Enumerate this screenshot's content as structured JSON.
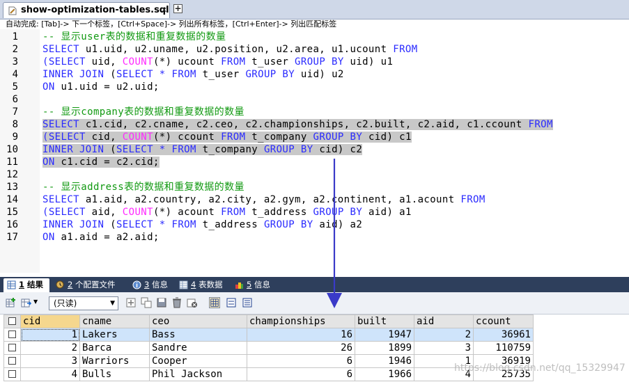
{
  "file_tab": {
    "title": "show-optimization-tables.sql",
    "close": "✕",
    "new_tab": "+"
  },
  "hint": "自动完成:  [Tab]-> 下一个标签，[Ctrl+Space]-> 列出所有标签，[Ctrl+Enter]-> 列出匹配标签",
  "editor": {
    "line_numbers": [
      "1",
      "2",
      "3",
      "4",
      "5",
      "6",
      "7",
      "8",
      "9",
      "10",
      "11",
      "12",
      "13",
      "14",
      "15",
      "16",
      "17"
    ],
    "lines": [
      [
        {
          "c": "cm",
          "t": "-- 显示user表的数据和重复数据的数量"
        }
      ],
      [
        {
          "c": "kw",
          "t": "SELECT"
        },
        {
          "t": " u1.uid, u2.uname, u2.position, u2.area, u1.ucount "
        },
        {
          "c": "kw",
          "t": "FROM"
        }
      ],
      [
        {
          "c": "kw",
          "t": "(SELECT"
        },
        {
          "t": " uid, "
        },
        {
          "c": "fn",
          "t": "COUNT"
        },
        {
          "t": "(*) ucount "
        },
        {
          "c": "kw",
          "t": "FROM"
        },
        {
          "t": " t_user "
        },
        {
          "c": "kw",
          "t": "GROUP BY"
        },
        {
          "t": " uid) u1"
        }
      ],
      [
        {
          "c": "kw",
          "t": "INNER JOIN"
        },
        {
          "t": " ("
        },
        {
          "c": "kw",
          "t": "SELECT"
        },
        {
          "t": " "
        },
        {
          "c": "kw",
          "t": "*"
        },
        {
          "t": " "
        },
        {
          "c": "kw",
          "t": "FROM"
        },
        {
          "t": " t_user "
        },
        {
          "c": "kw",
          "t": "GROUP BY"
        },
        {
          "t": " uid) u2"
        }
      ],
      [
        {
          "c": "kw",
          "t": "ON"
        },
        {
          "t": " u1.uid = u2.uid;"
        }
      ],
      [],
      [
        {
          "c": "cm",
          "t": "-- 显示company表的数据和重复数据的数量"
        }
      ],
      [
        {
          "c": "kw",
          "t": "SELECT"
        },
        {
          "t": " c1.cid, c2.cname, c2.ceo, c2.championships, c2.built, c2.aid, c1.ccount "
        },
        {
          "c": "kw",
          "t": "FROM"
        }
      ],
      [
        {
          "c": "kw",
          "t": "(SELECT"
        },
        {
          "t": " cid, "
        },
        {
          "c": "fn",
          "t": "COUNT"
        },
        {
          "t": "(*) ccount "
        },
        {
          "c": "kw",
          "t": "FROM"
        },
        {
          "t": " t_company "
        },
        {
          "c": "kw",
          "t": "GROUP BY"
        },
        {
          "t": " cid) c1"
        }
      ],
      [
        {
          "c": "kw",
          "t": "INNER JOIN"
        },
        {
          "t": " ("
        },
        {
          "c": "kw",
          "t": "SELECT"
        },
        {
          "t": " "
        },
        {
          "c": "kw",
          "t": "*"
        },
        {
          "t": " "
        },
        {
          "c": "kw",
          "t": "FROM"
        },
        {
          "t": " t_company "
        },
        {
          "c": "kw",
          "t": "GROUP BY"
        },
        {
          "t": " cid) c2"
        }
      ],
      [
        {
          "c": "kw",
          "t": "ON"
        },
        {
          "t": " c1.cid = c2.cid;"
        }
      ],
      [],
      [
        {
          "c": "cm",
          "t": "-- 显示address表的数据和重复数据的数量"
        }
      ],
      [
        {
          "c": "kw",
          "t": "SELECT"
        },
        {
          "t": " a1.aid, a2.country, a2.city, a2.gym, a2.continent, a1.acount "
        },
        {
          "c": "kw",
          "t": "FROM"
        }
      ],
      [
        {
          "c": "kw",
          "t": "(SELECT"
        },
        {
          "t": " aid, "
        },
        {
          "c": "fn",
          "t": "COUNT"
        },
        {
          "t": "(*) acount "
        },
        {
          "c": "kw",
          "t": "FROM"
        },
        {
          "t": " t_address "
        },
        {
          "c": "kw",
          "t": "GROUP BY"
        },
        {
          "t": " aid) a1"
        }
      ],
      [
        {
          "c": "kw",
          "t": "INNER JOIN"
        },
        {
          "t": " ("
        },
        {
          "c": "kw",
          "t": "SELECT"
        },
        {
          "t": " "
        },
        {
          "c": "kw",
          "t": "*"
        },
        {
          "t": " "
        },
        {
          "c": "kw",
          "t": "FROM"
        },
        {
          "t": " t_address "
        },
        {
          "c": "kw",
          "t": "GROUP BY"
        },
        {
          "t": " aid) a2"
        }
      ],
      [
        {
          "c": "kw",
          "t": "ON"
        },
        {
          "t": " a1.aid = a2.aid;"
        }
      ]
    ],
    "selected_lines": [
      8,
      9,
      10,
      11
    ]
  },
  "result_tabs": [
    {
      "key": "1",
      "label": "结果",
      "icon": "grid-icon",
      "active": true
    },
    {
      "key": "2",
      "label": "个配置文件",
      "icon": "profile-icon",
      "active": false
    },
    {
      "key": "3",
      "label": "信息",
      "icon": "info-icon",
      "active": false
    },
    {
      "key": "4",
      "label": "表数据",
      "icon": "table-data-icon",
      "active": false
    },
    {
      "key": "5",
      "label": "信息",
      "icon": "info-blocks-icon",
      "active": false
    }
  ],
  "toolbar": {
    "mode_value": "(只读)"
  },
  "grid": {
    "columns": [
      "cid",
      "cname",
      "ceo",
      "championships",
      "built",
      "aid",
      "ccount"
    ],
    "numeric": [
      true,
      false,
      false,
      true,
      true,
      true,
      true
    ],
    "rows": [
      [
        "1",
        "Lakers",
        "Bass",
        "16",
        "1947",
        "2",
        "36961"
      ],
      [
        "2",
        "Barca",
        "Sandre",
        "26",
        "1899",
        "3",
        "110759"
      ],
      [
        "3",
        "Warriors",
        "Cooper",
        "6",
        "1946",
        "1",
        "36919"
      ],
      [
        "4",
        "Bulls",
        "Phil Jackson",
        "6",
        "1966",
        "4",
        "25735"
      ]
    ]
  },
  "watermark": "https://blog.csdn.net/qq_15329947",
  "colors": {
    "keyword": "#2a2aff",
    "function": "#ff2aff",
    "comment": "#119911",
    "arrow": "#3a3ac8",
    "selection": "#c8c8c8"
  }
}
